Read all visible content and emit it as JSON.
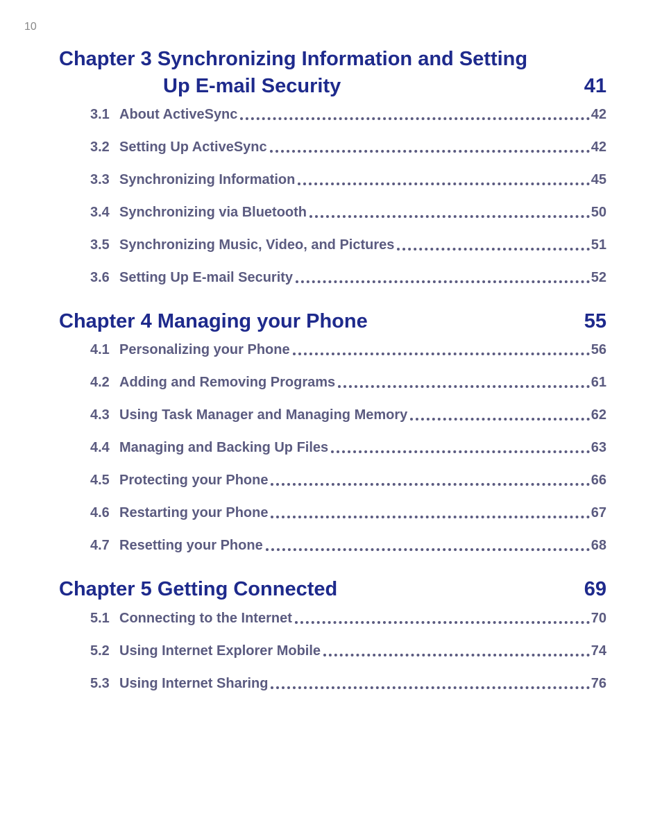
{
  "page_number": "10",
  "chapters": [
    {
      "title_line1": "Chapter 3 Synchronizing Information and Setting",
      "title_line2": "Up E-mail Security",
      "page": "41",
      "items": [
        {
          "num": "3.1",
          "label": "About ActiveSync",
          "pg": "42"
        },
        {
          "num": "3.2",
          "label": "Setting Up ActiveSync",
          "pg": "42"
        },
        {
          "num": "3.3",
          "label": "Synchronizing Information",
          "pg": "45"
        },
        {
          "num": "3.4",
          "label": "Synchronizing via Bluetooth",
          "pg": "50"
        },
        {
          "num": "3.5",
          "label": "Synchronizing Music, Video, and Pictures",
          "pg": "51"
        },
        {
          "num": "3.6",
          "label": "Setting Up E-mail Security",
          "pg": "52"
        }
      ]
    },
    {
      "title": "Chapter 4 Managing your Phone",
      "page": "55",
      "items": [
        {
          "num": "4.1",
          "label": "Personalizing your Phone",
          "pg": "56"
        },
        {
          "num": "4.2",
          "label": "Adding and Removing Programs",
          "pg": "61"
        },
        {
          "num": "4.3",
          "label": "Using Task Manager and Managing Memory",
          "pg": "62"
        },
        {
          "num": "4.4",
          "label": "Managing and Backing Up Files",
          "pg": "63"
        },
        {
          "num": "4.5",
          "label": "Protecting your Phone",
          "pg": "66"
        },
        {
          "num": "4.6",
          "label": "Restarting your Phone",
          "pg": "67"
        },
        {
          "num": "4.7",
          "label": "Resetting your Phone",
          "pg": "68"
        }
      ]
    },
    {
      "title": "Chapter 5 Getting Connected",
      "page": "69",
      "items": [
        {
          "num": "5.1",
          "label": "Connecting to the Internet",
          "pg": "70"
        },
        {
          "num": "5.2",
          "label": "Using Internet Explorer Mobile",
          "pg": "74"
        },
        {
          "num": "5.3",
          "label": "Using Internet Sharing",
          "pg": "76"
        }
      ]
    }
  ]
}
